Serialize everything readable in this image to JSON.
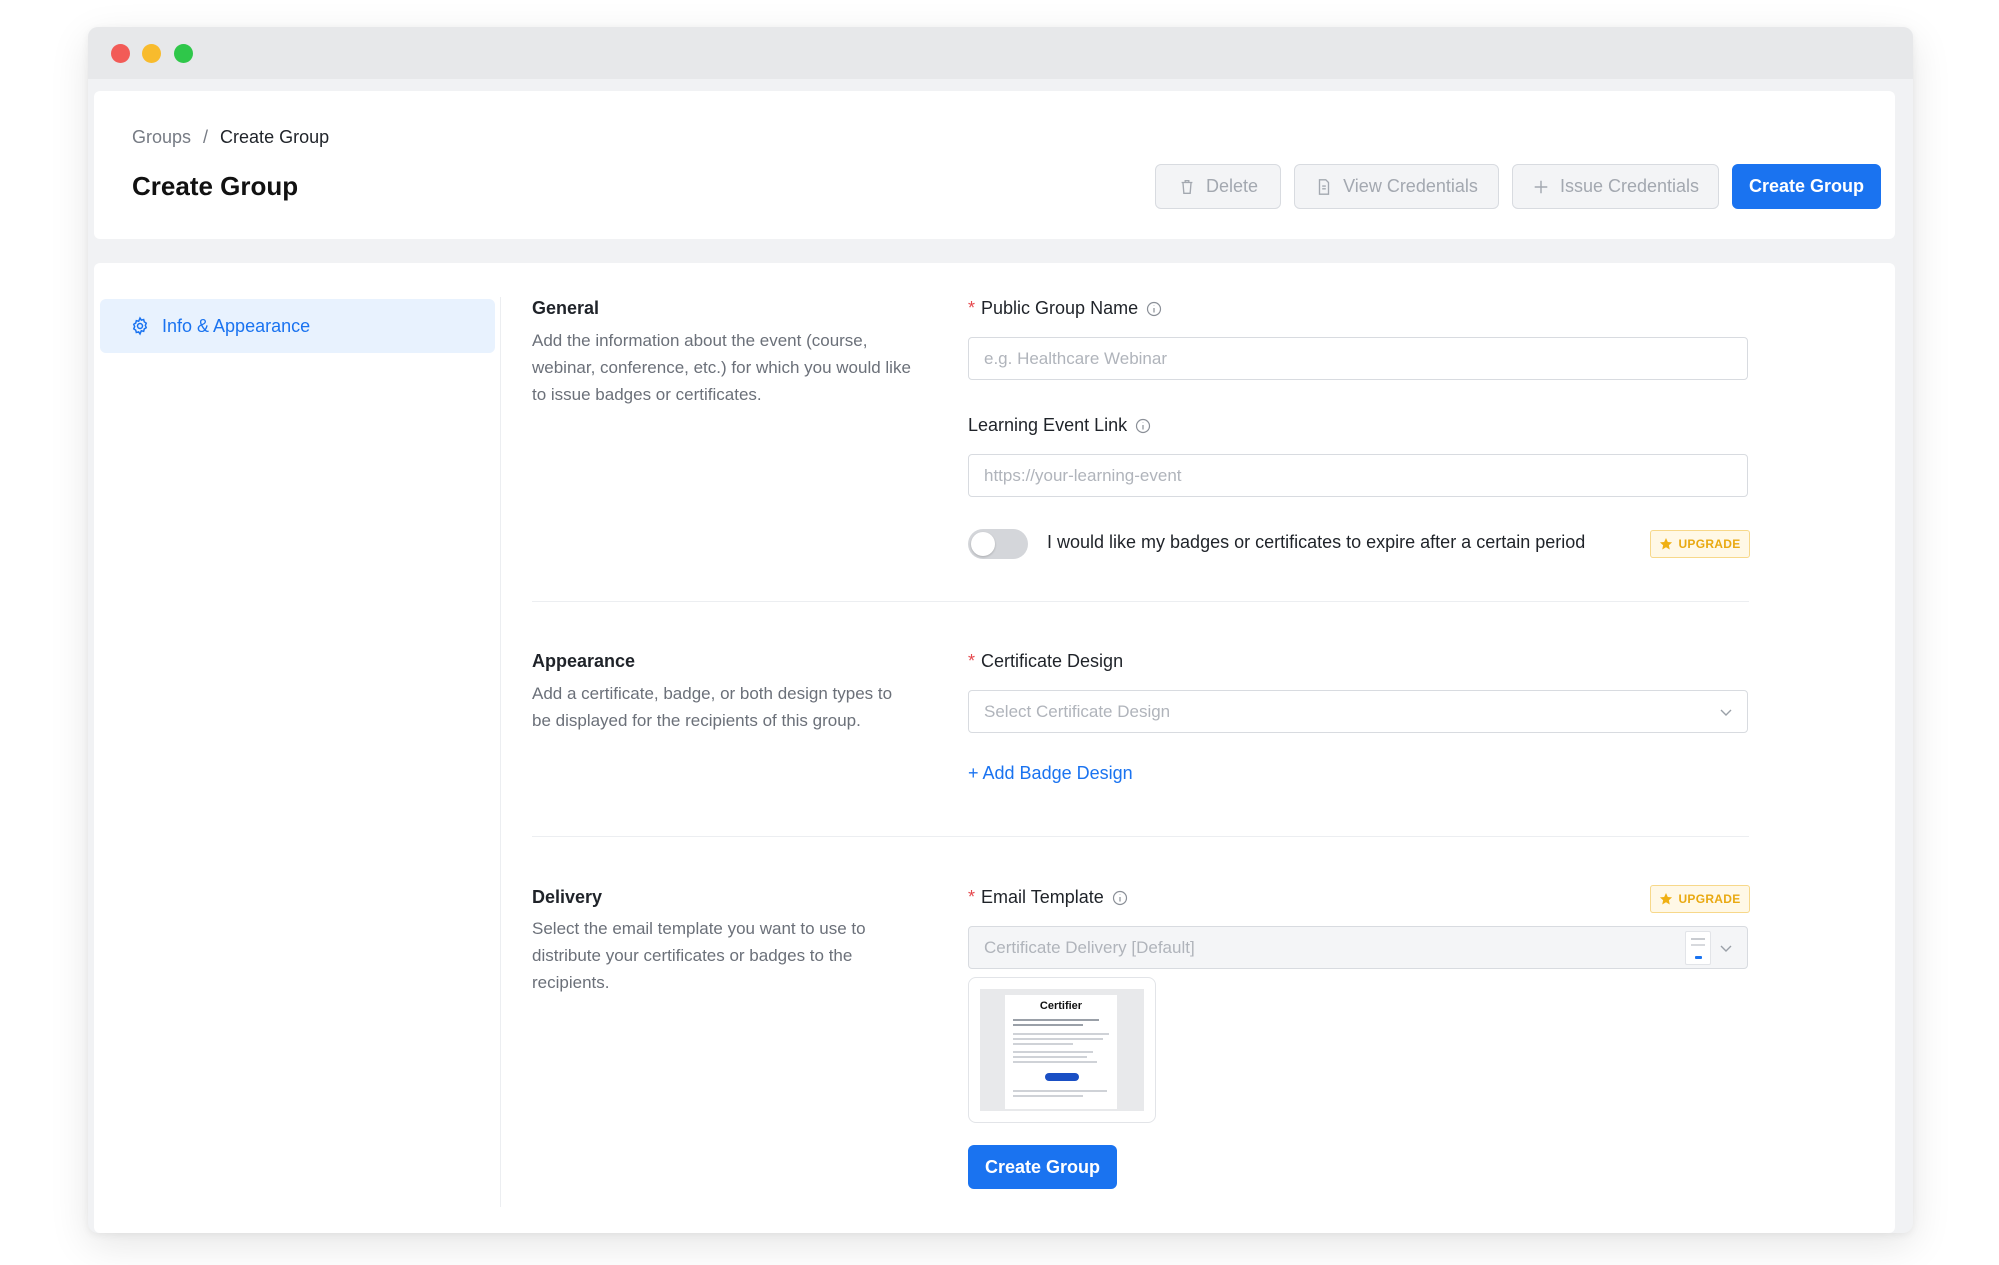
{
  "breadcrumb": {
    "parent": "Groups",
    "separator": "/",
    "current": "Create Group"
  },
  "page_title": "Create Group",
  "toolbar": {
    "delete_label": "Delete",
    "view_credentials_label": "View Credentials",
    "issue_credentials_label": "Issue Credentials",
    "create_group_label": "Create Group"
  },
  "sidebar": {
    "items": [
      {
        "label": "Info & Appearance",
        "icon": "gear-icon",
        "active": true
      }
    ]
  },
  "general": {
    "title": "General",
    "description": "Add the information about the event (course, webinar, conference, etc.) for which you would like to issue badges or certificates.",
    "public_group_name": {
      "required_mark": "*",
      "label": "Public Group Name",
      "placeholder": "e.g. Healthcare Webinar",
      "value": ""
    },
    "learning_event_link": {
      "label": "Learning Event Link",
      "placeholder": "https://your-learning-event",
      "value": ""
    },
    "expire_toggle": {
      "label": "I would like my badges or certificates to expire after a certain period",
      "checked": false
    },
    "upgrade_label": "UPGRADE"
  },
  "appearance": {
    "title": "Appearance",
    "description": "Add a certificate, badge, or both design types to be displayed for the recipients of this group.",
    "certificate_design": {
      "required_mark": "*",
      "label": "Certificate Design",
      "placeholder": "Select Certificate Design"
    },
    "add_badge_link": "+ Add Badge Design"
  },
  "delivery": {
    "title": "Delivery",
    "description": "Select the email template you want to use to distribute your certificates or badges to the recipients.",
    "email_template": {
      "required_mark": "*",
      "label": "Email Template",
      "value": "Certificate Delivery [Default]"
    },
    "upgrade_label": "UPGRADE",
    "preview_logo": "Certifier"
  },
  "submit_label": "Create Group",
  "colors": {
    "accent": "#1a73f0",
    "upgrade": "#e9a911",
    "required": "#e5484d"
  }
}
